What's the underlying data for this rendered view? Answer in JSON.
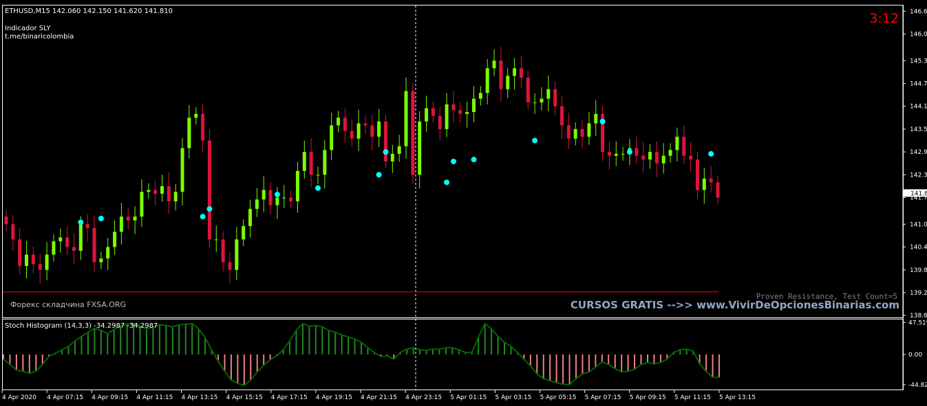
{
  "header": {
    "symbol_line": "ETHUSD,M15  142.060 142.150 141.620 141.810",
    "indicator_name": "Indicador SLY",
    "indicator_link": "t.me/binaricolombia",
    "timer": "3:12",
    "current_price_label": "141.8"
  },
  "overlays": {
    "watermark_left": "Форекс складчина FXSA.ORG",
    "proven_resistance": "Proven Resistance, Test Count=5",
    "promo": "CURSOS GRATIS -->> www.VivirDeOpcionesBinarias.com"
  },
  "colors": {
    "background": "#000000",
    "bull": "#7CFC00",
    "bear": "#DC143C",
    "dots": "#00FFFF",
    "timer": "#FF0000",
    "hist_pos": "#228B22",
    "hist_neg": "#F08080",
    "hist_line": "#006400",
    "axis": "#FFFFFF",
    "resistance": "#FF0000",
    "promo": "#8FA8C8"
  },
  "chart_data": [
    {
      "type": "candlestick",
      "title": "ETHUSD,M15",
      "price_axis_ticks": [
        "146.60",
        "146.00",
        "145.30",
        "144.70",
        "144.10",
        "143.50",
        "142.90",
        "142.30",
        "141.70",
        "141.00",
        "140.40",
        "139.80",
        "139.20",
        "138.60"
      ],
      "ylim": [
        138.55,
        146.75
      ],
      "time_axis_ticks": [
        "4 Apr 2020",
        "4 Apr 07:15",
        "4 Apr 09:15",
        "4 Apr 11:15",
        "4 Apr 13:15",
        "4 Apr 15:15",
        "4 Apr 17:15",
        "4 Apr 19:15",
        "4 Apr 21:15",
        "4 Apr 23:15",
        "5 Apr 01:15",
        "5 Apr 03:15",
        "5 Apr 05:15",
        "5 Apr 07:15",
        "5 Apr 09:15",
        "5 Apr 11:15",
        "5 Apr 13:15"
      ],
      "ohlc_close": [
        141.0,
        140.6,
        139.9,
        140.2,
        139.95,
        139.8,
        140.2,
        140.55,
        140.65,
        140.4,
        140.3,
        141.0,
        140.9,
        140.0,
        140.1,
        140.4,
        140.8,
        141.2,
        141.1,
        141.2,
        141.85,
        141.9,
        141.8,
        142.0,
        141.6,
        141.85,
        143.0,
        143.8,
        143.9,
        143.2,
        140.6,
        140.6,
        140.0,
        139.8,
        140.6,
        140.95,
        141.4,
        141.65,
        141.9,
        141.5,
        141.7,
        141.7,
        141.6,
        142.4,
        142.9,
        142.3,
        142.3,
        142.95,
        143.6,
        143.8,
        143.45,
        143.25,
        143.65,
        143.6,
        143.3,
        143.7,
        142.65,
        142.85,
        143.05,
        144.5,
        142.3,
        143.7,
        144.05,
        143.85,
        143.5,
        144.15,
        144.0,
        143.9,
        143.95,
        144.3,
        144.45,
        145.1,
        145.3,
        144.55,
        144.9,
        145.1,
        144.85,
        144.2,
        144.2,
        144.3,
        144.55,
        144.1,
        143.6,
        143.25,
        143.5,
        143.3,
        143.65,
        143.9,
        142.9,
        142.8,
        142.85,
        142.85,
        143.0,
        142.8,
        142.7,
        142.9,
        142.6,
        142.8,
        142.95,
        143.3,
        142.8,
        142.7,
        141.9,
        142.2,
        142.1,
        141.7
      ],
      "signal_dots_price": [
        141.05,
        141.15,
        141.4,
        141.95,
        141.2,
        141.78,
        142.9,
        142.3,
        142.1,
        142.65,
        142.7,
        143.2,
        143.7,
        142.9,
        142.85
      ],
      "current_price": 141.81,
      "resistance_level": 139.22
    },
    {
      "type": "histogram",
      "title": "Stoch Histogram (14,3,3) -34.2987 -34.2987",
      "y_ticks": [
        "47.5193",
        "0.00",
        "-44.82"
      ],
      "ylim": [
        -52,
        52
      ],
      "values": [
        -7,
        -15,
        -23,
        -25,
        -28,
        -25,
        -15,
        -3,
        2,
        7,
        12,
        20,
        27,
        33,
        39,
        36,
        31,
        37,
        43,
        45,
        46,
        43,
        38,
        41,
        44,
        43,
        41,
        44,
        45,
        46,
        38,
        25,
        7,
        -10,
        -25,
        -38,
        -43,
        -46,
        -38,
        -26,
        -16,
        -8,
        -2,
        7,
        20,
        36,
        46,
        42,
        43,
        41,
        36,
        33,
        29,
        26,
        23,
        18,
        10,
        3,
        -3,
        -2,
        -7,
        3,
        8,
        10,
        7,
        6,
        8,
        8,
        10,
        10,
        7,
        3,
        3,
        26,
        46,
        38,
        27,
        18,
        12,
        3,
        -7,
        -17,
        -29,
        -36,
        -39,
        -42,
        -44,
        -45,
        -36,
        -29,
        -26,
        -19,
        -11,
        -15,
        -21,
        -26,
        -25,
        -22,
        -15,
        -12,
        -14,
        -12,
        -7,
        3,
        7,
        8,
        5,
        -14,
        -25,
        -34,
        -34
      ]
    }
  ]
}
